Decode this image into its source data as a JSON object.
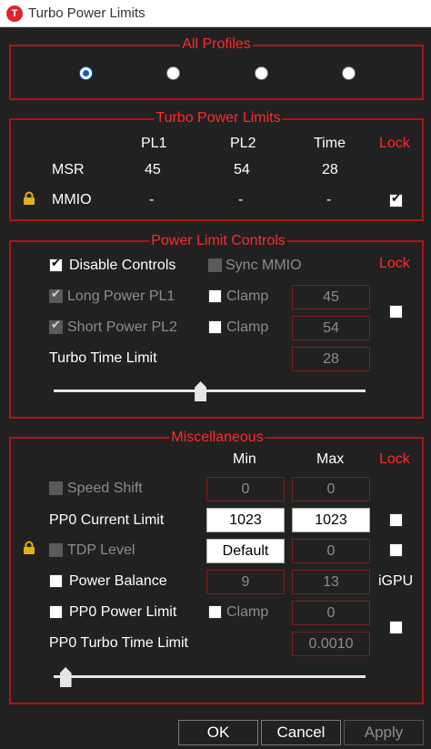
{
  "window": {
    "title": "Turbo Power Limits",
    "icon_letter": "T"
  },
  "all_profiles": {
    "legend": "All Profiles",
    "selected_index": 0
  },
  "turbo_power_limits": {
    "legend": "Turbo Power Limits",
    "headers": {
      "pl1": "PL1",
      "pl2": "PL2",
      "time": "Time",
      "lock": "Lock"
    },
    "msr": {
      "label": "MSR",
      "pl1": "45",
      "pl2": "54",
      "time": "28"
    },
    "mmio": {
      "label": "MMIO",
      "pl1": "-",
      "pl2": "-",
      "time": "-",
      "lock_checked": true
    }
  },
  "power_limit_controls": {
    "legend": "Power Limit Controls",
    "lock_label": "Lock",
    "disable_controls": {
      "label": "Disable Controls",
      "checked": true
    },
    "sync_mmio": {
      "label": "Sync MMIO",
      "checked": false
    },
    "long_power": {
      "label": "Long Power PL1",
      "checked": true,
      "clamp_label": "Clamp",
      "value": "45"
    },
    "short_power": {
      "label": "Short Power PL2",
      "checked": true,
      "clamp_label": "Clamp",
      "value": "54"
    },
    "turbo_time_limit": {
      "label": "Turbo Time Limit",
      "value": "28"
    },
    "slider_fraction": 0.47,
    "lock_checked": false
  },
  "miscellaneous": {
    "legend": "Miscellaneous",
    "headers": {
      "min": "Min",
      "max": "Max",
      "lock": "Lock"
    },
    "speed_shift": {
      "label": "Speed Shift",
      "min": "0",
      "max": "0"
    },
    "pp0_current_limit": {
      "label": "PP0 Current Limit",
      "min": "1023",
      "max": "1023"
    },
    "tdp_level": {
      "label": "TDP Level",
      "min": "Default",
      "max": "0"
    },
    "power_balance": {
      "label": "Power Balance",
      "min": "9",
      "max": "13",
      "suffix": "iGPU"
    },
    "pp0_power_limit": {
      "label": "PP0 Power Limit",
      "clamp_label": "Clamp",
      "max": "0"
    },
    "pp0_turbo_time_limit": {
      "label": "PP0 Turbo Time Limit",
      "value": "0.0010"
    },
    "slider_fraction": 0.02
  },
  "buttons": {
    "ok": "OK",
    "cancel": "Cancel",
    "apply": "Apply"
  },
  "colors": {
    "accent_red": "#ff2a2a",
    "border_red": "#b21313",
    "radio_blue": "#0c5fd1",
    "background": "#212121"
  }
}
